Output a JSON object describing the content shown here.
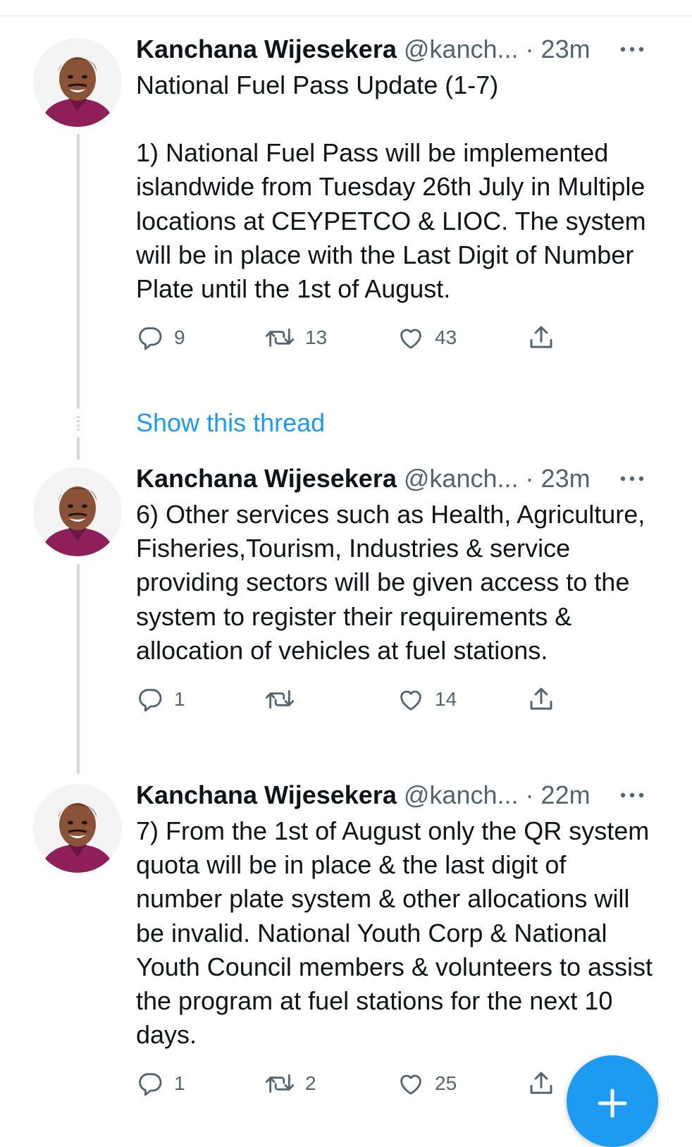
{
  "tweets": [
    {
      "author": "Kanchana Wijesekera",
      "handle": "@kanch...",
      "sep": "·",
      "time": "23m",
      "title": "National Fuel Pass Update (1-7)",
      "text": "1) National Fuel Pass will be implemented islandwide from Tuesday 26th July in Multiple locations at CEYPETCO & LIOC. The system will be in place with the Last Digit of Number Plate until the 1st of August.",
      "replies": "9",
      "retweets": "13",
      "likes": "43"
    },
    {
      "author": "Kanchana Wijesekera",
      "handle": "@kanch...",
      "sep": "·",
      "time": "23m",
      "text": "6) Other services such as Health, Agriculture, Fisheries,Tourism, Industries & service providing sectors will be given access to the system to register their requirements & allocation of vehicles at fuel stations.",
      "replies": "1",
      "retweets": "",
      "likes": "14"
    },
    {
      "author": "Kanchana Wijesekera",
      "handle": "@kanch...",
      "sep": "·",
      "time": "22m",
      "text": "7) From the 1st of August only the QR system quota will be in place & the last digit of number plate system & other allocations will be invalid. National Youth Corp & National Youth Council members & volunteers to assist the program at fuel stations for the next 10 days.",
      "replies": "1",
      "retweets": "2",
      "likes": "25"
    }
  ],
  "show_thread_label": "Show this thread",
  "colors": {
    "link": "#1d9bf0",
    "muted": "#536471",
    "text": "#0f1419",
    "thread_line": "#cfd9de"
  },
  "icons": [
    "more-icon",
    "reply-icon",
    "retweet-icon",
    "like-icon",
    "share-icon",
    "plus-icon",
    "avatar"
  ]
}
